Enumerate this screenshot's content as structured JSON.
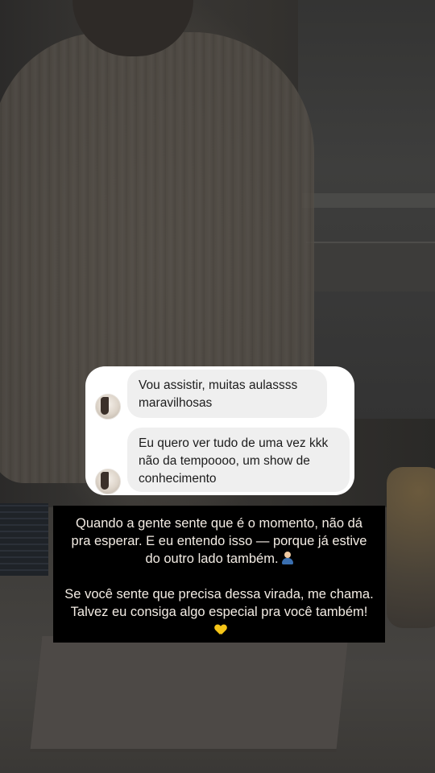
{
  "comments": [
    {
      "avatar_icon": "user-avatar-icon",
      "text": "Vou assistir,  muitas aulassss maravilhosas"
    },
    {
      "avatar_icon": "user-avatar-icon",
      "text": "Eu quero ver tudo de uma vez kkk não da tempoooo,  um show de conhecimento"
    }
  ],
  "caption": {
    "paragraph1": "Quando a gente sente que é o momento, não dá pra esperar. E eu entendo isso — porque já estive do outro lado também.",
    "paragraph1_emoji": "person-at-computer-emoji",
    "paragraph2": "Se você sente que precisa dessa virada, me chama. Talvez eu consiga algo especial pra você também!",
    "paragraph2_emoji": "yellow-heart-emoji"
  },
  "colors": {
    "card_bg": "#ffffff",
    "bubble_bg": "#efefef",
    "caption_bg": "#000000",
    "caption_text": "#f3ece4",
    "heart": "#f5c518"
  }
}
